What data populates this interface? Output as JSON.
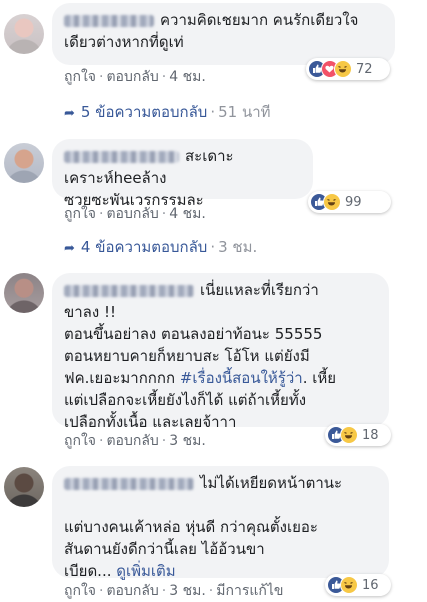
{
  "labels": {
    "like": "ถูกใจ",
    "reply": "ตอบกลับ",
    "dot": "·"
  },
  "colors": {
    "link": "#385898",
    "meta": "#616770",
    "bubble": "#f2f3f5"
  },
  "comments": [
    {
      "text": "ความคิดเชยมาก คนรักเดียวใจ\nเดียวต่างหากที่ดูเท่",
      "time": "4 ชม.",
      "reactions": [
        "like-icon",
        "love-icon",
        "haha-icon"
      ],
      "reaction_count": "72",
      "replies": {
        "label": "5 ข้อความตอบกลับ",
        "time": "51 นาที"
      }
    },
    {
      "text": "สะเดาะเคราะห์heeล้าง\nซวยซะพันเวรกรรมละ",
      "time": "4 ชม.",
      "reactions": [
        "like-icon",
        "haha-icon"
      ],
      "reaction_count": "99",
      "replies": {
        "label": "4 ข้อความตอบกลับ",
        "time": "3 ชม."
      }
    },
    {
      "text_a": "เนี่ยแหละที่เรียกว่า\nขาลง !!\nตอนขึ้นอย่าลง ตอนลงอย่าท้อนะ 55555\nตอนหยาบคายก็หยาบสะ โอ้โห แต่ยังมี\nฟค.เยอะมากกกก ",
      "hashtag": "#เรื่องนี้สอนให้รู้ว่า",
      "text_b": ". เหี้ย\nแต่เปลือกจะเหี้ยยังไงก็ได้ แต่ถ้าเหี้ยทั้ง\nเปลือกทั้งเนื้อ และเลยจ้าาา",
      "time": "3 ชม.",
      "reactions": [
        "like-icon",
        "haha-icon"
      ],
      "reaction_count": "18"
    },
    {
      "text_a": "ไม่ได้เหยียดหน้าตานะ\n\nแต่บางคนเค้าหล่อ หุ่นดี กว่าคุณตั้งเยอะ\nสันดานยังดีกว่านี้เลย ไอ้อ้วนขา\nเบียด... ",
      "see_more": "ดูเพิ่มเติม",
      "time": "3 ชม.",
      "edited": "มีการแก้ไข",
      "reactions": [
        "like-icon",
        "haha-icon"
      ],
      "reaction_count": "16"
    }
  ]
}
